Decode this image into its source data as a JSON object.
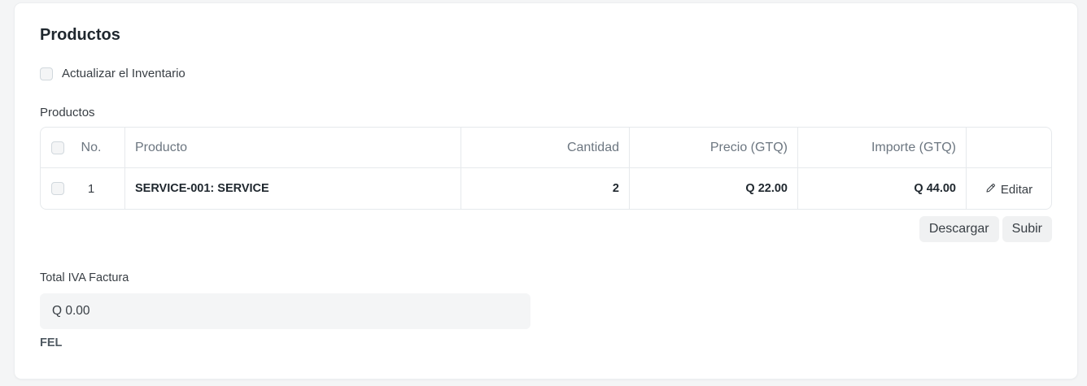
{
  "section": {
    "title": "Productos"
  },
  "update_stock": {
    "label": "Actualizar el Inventario"
  },
  "items_table": {
    "label": "Productos",
    "columns": {
      "no": "No.",
      "item": "Producto",
      "qty": "Cantidad",
      "rate": "Precio (GTQ)",
      "amount": "Importe (GTQ)"
    },
    "rows": [
      {
        "no": "1",
        "item": "SERVICE-001: SERVICE",
        "qty": "2",
        "rate": "Q 22.00",
        "amount": "Q 44.00",
        "edit_label": "Editar"
      }
    ]
  },
  "actions": {
    "download_label": "Descargar",
    "upload_label": "Subir"
  },
  "tax": {
    "label": "Total IVA Factura",
    "value": "Q 0.00"
  },
  "fel": {
    "label": "FEL"
  },
  "icons": {
    "edit": "pencil-icon"
  }
}
